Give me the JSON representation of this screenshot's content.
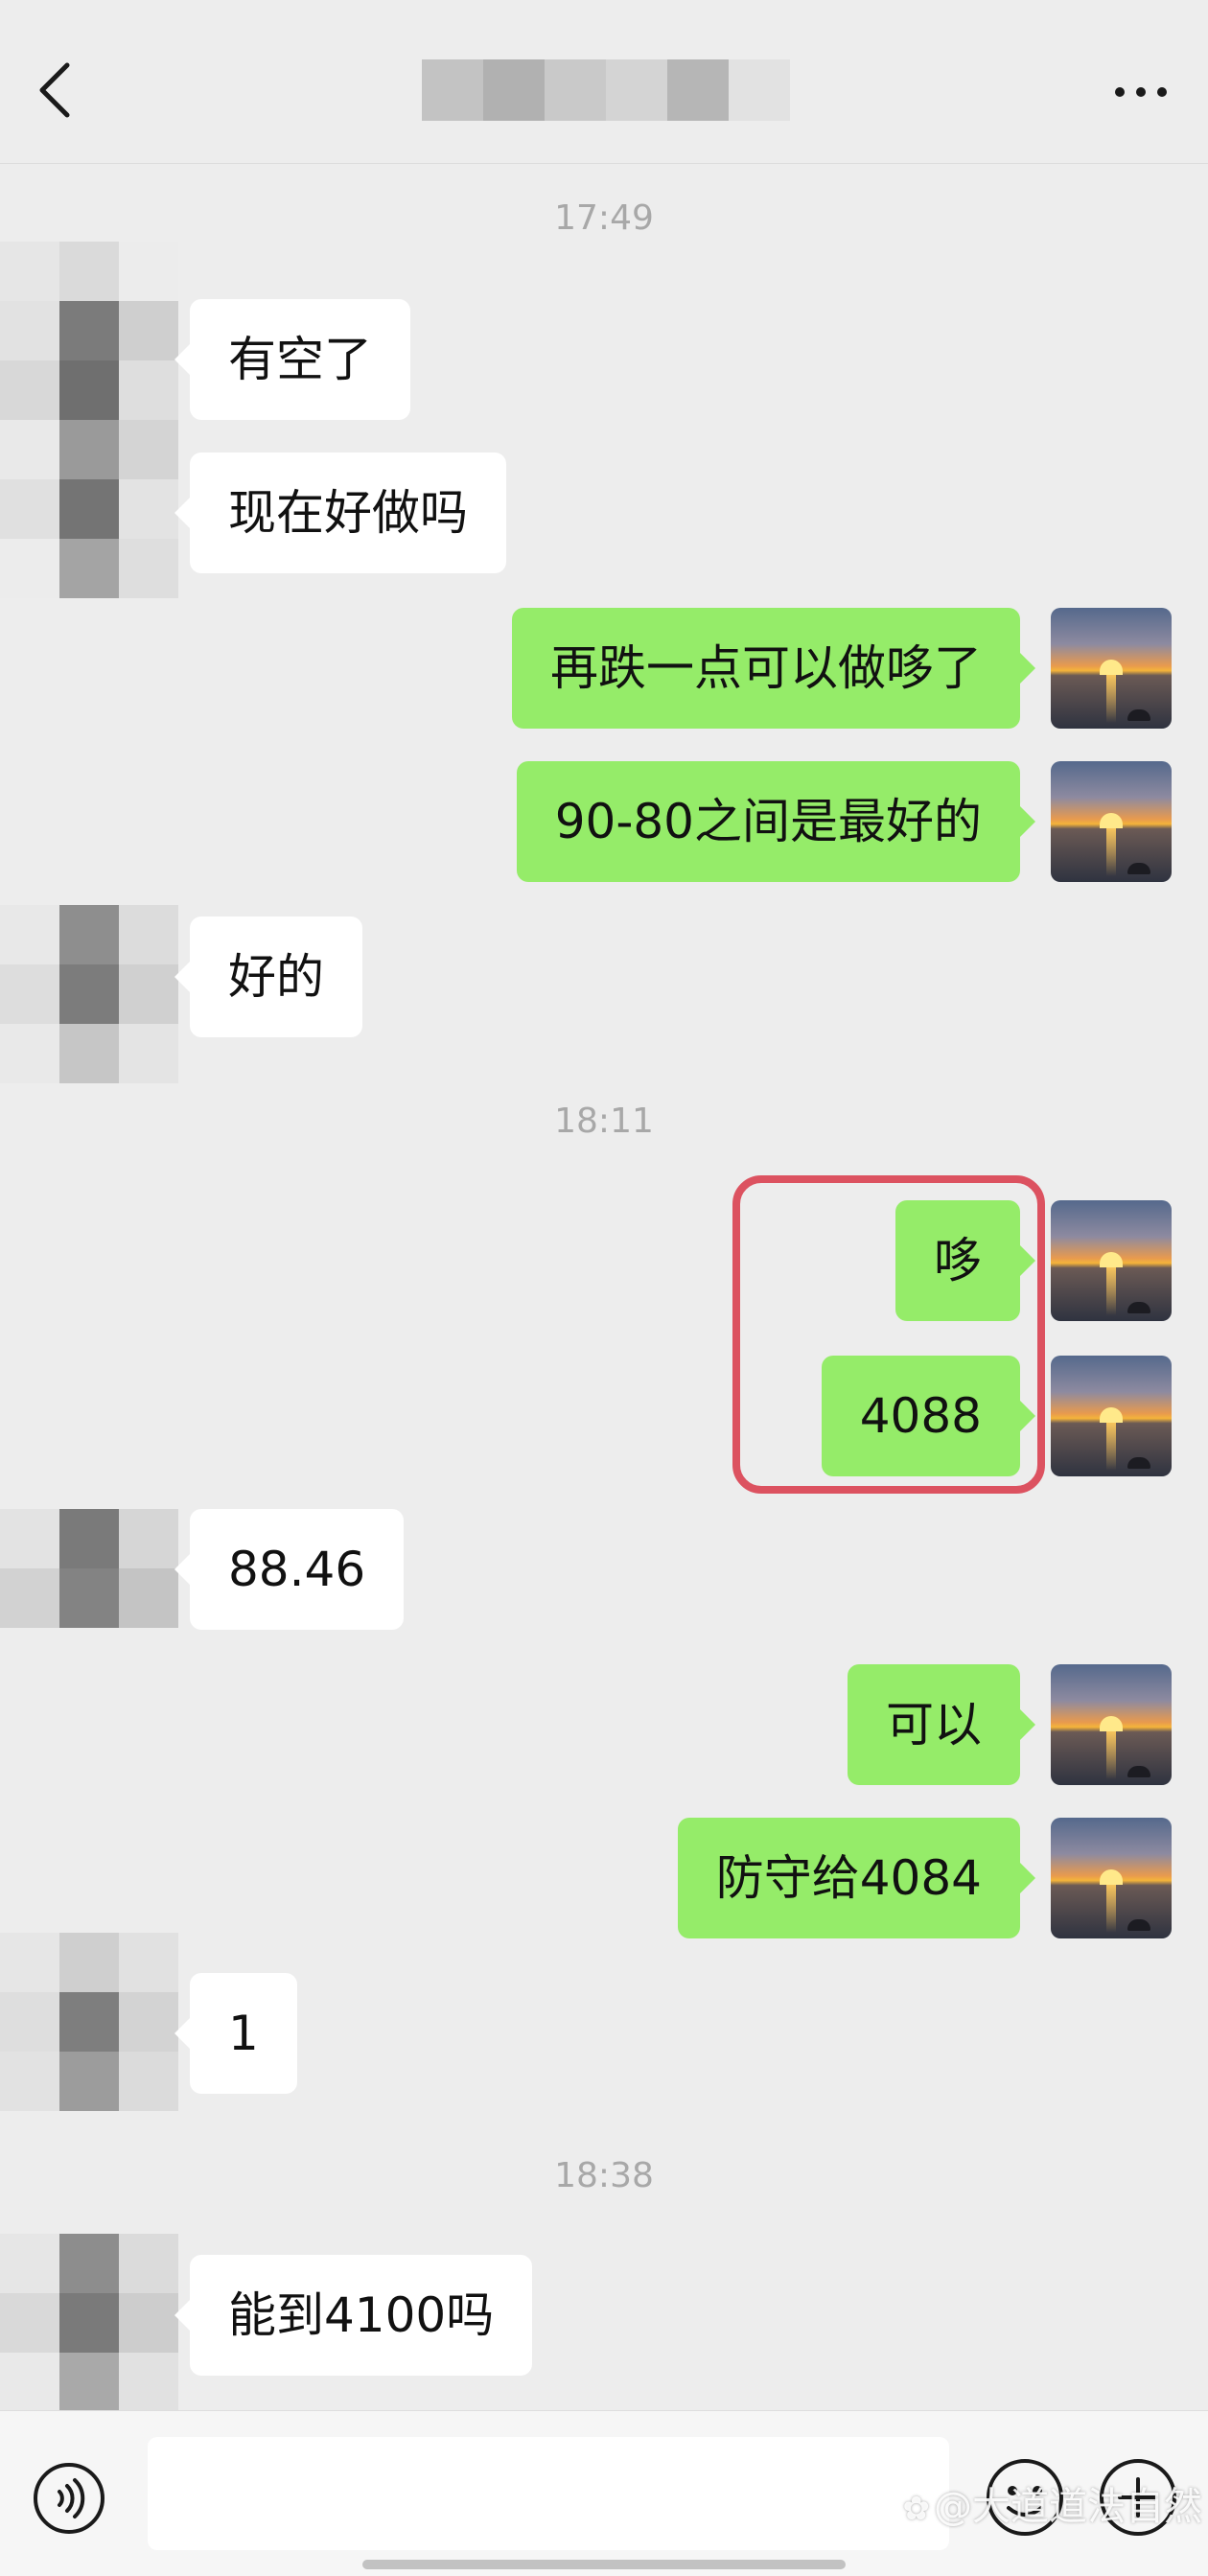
{
  "header": {
    "contact_name_blurred": true
  },
  "messages": [
    {
      "type": "time",
      "text": "17:49"
    },
    {
      "type": "msg",
      "side": "left",
      "text": "有空了"
    },
    {
      "type": "msg",
      "side": "left",
      "text": "现在好做吗"
    },
    {
      "type": "msg",
      "side": "right",
      "text": "再跌一点可以做哆了"
    },
    {
      "type": "msg",
      "side": "right",
      "text": "90-80之间是最好的"
    },
    {
      "type": "msg",
      "side": "left",
      "text": "好的"
    },
    {
      "type": "time",
      "text": "18:11"
    },
    {
      "type": "msg",
      "side": "right",
      "text": "哆",
      "highlighted": true
    },
    {
      "type": "msg",
      "side": "right",
      "text": "4088",
      "highlighted": true
    },
    {
      "type": "msg",
      "side": "left",
      "text": "88.46"
    },
    {
      "type": "msg",
      "side": "right",
      "text": "可以"
    },
    {
      "type": "msg",
      "side": "right",
      "text": "防守给4084"
    },
    {
      "type": "msg",
      "side": "left",
      "text": "1"
    },
    {
      "type": "time",
      "text": "18:38"
    },
    {
      "type": "msg",
      "side": "left",
      "text": "能到4100吗"
    }
  ],
  "input": {
    "value": ""
  },
  "icons": {
    "back": "chevron-left-icon",
    "more": "more-dots-icon",
    "voice": "voice-icon",
    "emoji": "emoji-icon",
    "plus": "plus-icon"
  },
  "watermark": {
    "text": "@大道道法自然"
  },
  "colors": {
    "background": "#ededed",
    "bubble_self": "#95ec69",
    "bubble_other": "#ffffff",
    "highlight_border": "#dc5260"
  }
}
